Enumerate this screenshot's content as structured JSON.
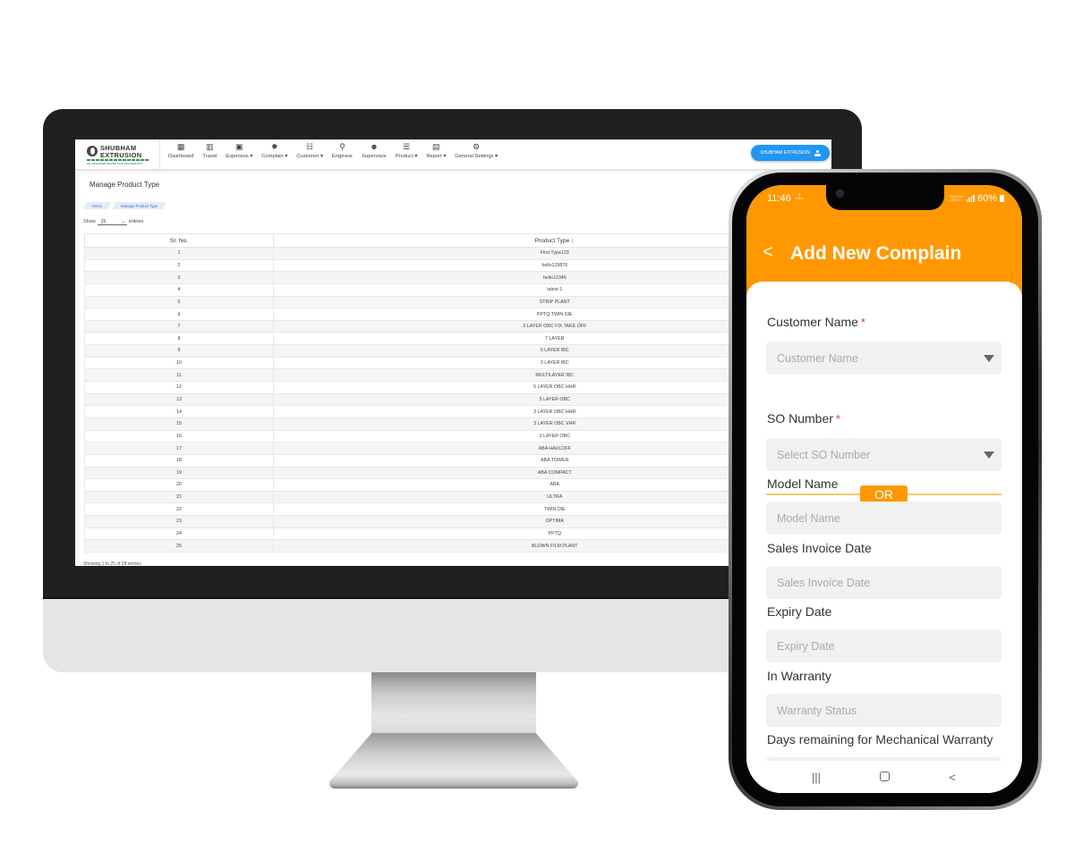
{
  "desktop": {
    "brand": {
      "name_line1": "SHUBHAM",
      "name_line2": "EXTRUSION",
      "tagline": "AN ADVANCED BLOWN FILM TECHNOLOGY"
    },
    "nav": [
      {
        "label": "Dashboard",
        "icon": "dashboard-icon",
        "glyph": "▦"
      },
      {
        "label": "Travel",
        "icon": "map-icon",
        "glyph": "▥"
      },
      {
        "label": "Expenses ▾",
        "icon": "money-icon",
        "glyph": "▣"
      },
      {
        "label": "Complain ▾",
        "icon": "bug-icon",
        "glyph": "✹"
      },
      {
        "label": "Customer ▾",
        "icon": "people-icon",
        "glyph": "☷"
      },
      {
        "label": "Engineer",
        "icon": "bike-icon",
        "glyph": "⚲"
      },
      {
        "label": "Supervisor",
        "icon": "group-icon",
        "glyph": "☻"
      },
      {
        "label": "Product ▾",
        "icon": "list-icon",
        "glyph": "☰"
      },
      {
        "label": "Report ▾",
        "icon": "report-icon",
        "glyph": "▤"
      },
      {
        "label": "General Settings ▾",
        "icon": "gear-icon",
        "glyph": "⚙"
      }
    ],
    "user_button": "SHUBHAM EXTRUSION",
    "page_title": "Manage Product Type",
    "breadcrumb": [
      "Home",
      "Manage Product Type"
    ],
    "show_label": "Show",
    "entries_value": "25",
    "entries_label": "entries",
    "table": {
      "columns": [
        "Sr. No.",
        "Product Type ↕"
      ],
      "rows": [
        [
          "1",
          "First Type123"
        ],
        [
          "2",
          "hello129876"
        ],
        [
          "3",
          "hello12345"
        ],
        [
          "4",
          "latest 1"
        ],
        [
          "5",
          "STRIP PLANT"
        ],
        [
          "6",
          "PPTQ TWIN DIE"
        ],
        [
          "7",
          "3 LAYER OBC FIX TAKE OFF"
        ],
        [
          "8",
          "7 LAYER"
        ],
        [
          "9",
          "5 LAYER IBC"
        ],
        [
          "10",
          "3 LAYER IBC"
        ],
        [
          "11",
          "MULTILAYER IBC"
        ],
        [
          "12",
          "5 LAYER OBC HHR"
        ],
        [
          "13",
          "5 LAYER OBC"
        ],
        [
          "14",
          "3 LAYER OBC HHR"
        ],
        [
          "15",
          "3 LAYER OBC VHR"
        ],
        [
          "16",
          "3 LAYER OBC"
        ],
        [
          "17",
          "ABA HAULOFF"
        ],
        [
          "18",
          "ABA TOWER"
        ],
        [
          "19",
          "ABA COMPACT"
        ],
        [
          "20",
          "ABA"
        ],
        [
          "21",
          "ULTRA"
        ],
        [
          "22",
          "TWIN DIE"
        ],
        [
          "23",
          "OPTIMA"
        ],
        [
          "24",
          "PPTQ"
        ],
        [
          "25",
          "BLOWN FILM PLANT"
        ]
      ]
    },
    "footer": "Showing 1 to 25 of 28 entries"
  },
  "mobile": {
    "status": {
      "time": "11:46",
      "kbs_top": "0",
      "kbs_bottom": "KB/s",
      "net_top": "Vo0 4G+",
      "net_bottom": "LTE1 ↑↓",
      "battery": "60%"
    },
    "title": "Add New Complain",
    "back": "<",
    "or_label": "OR",
    "fields": [
      {
        "label": "Customer Name",
        "required": "*",
        "placeholder": "Customer Name",
        "dropdown": true
      },
      {
        "label": "SO Number",
        "required": "*",
        "placeholder": "Select SO Number",
        "dropdown": true
      },
      {
        "label": "Model Name",
        "required": "",
        "placeholder": "Model Name",
        "dropdown": false
      },
      {
        "label": "Sales Invoice Date",
        "required": "",
        "placeholder": "Sales Invoice Date",
        "dropdown": false
      },
      {
        "label": "Expiry Date",
        "required": "",
        "placeholder": "Expiry Date",
        "dropdown": false
      },
      {
        "label": "In Warranty",
        "required": "",
        "placeholder": "Warranty Status",
        "dropdown": false
      },
      {
        "label": "Days remaining for Mechanical Warranty",
        "required": "",
        "placeholder": "",
        "dropdown": false
      }
    ],
    "navbar": {
      "recents": "|||",
      "back": "<"
    },
    "colors": {
      "accent": "#ff9800",
      "required": "#e53935",
      "primary_button": "#2196f3"
    }
  }
}
